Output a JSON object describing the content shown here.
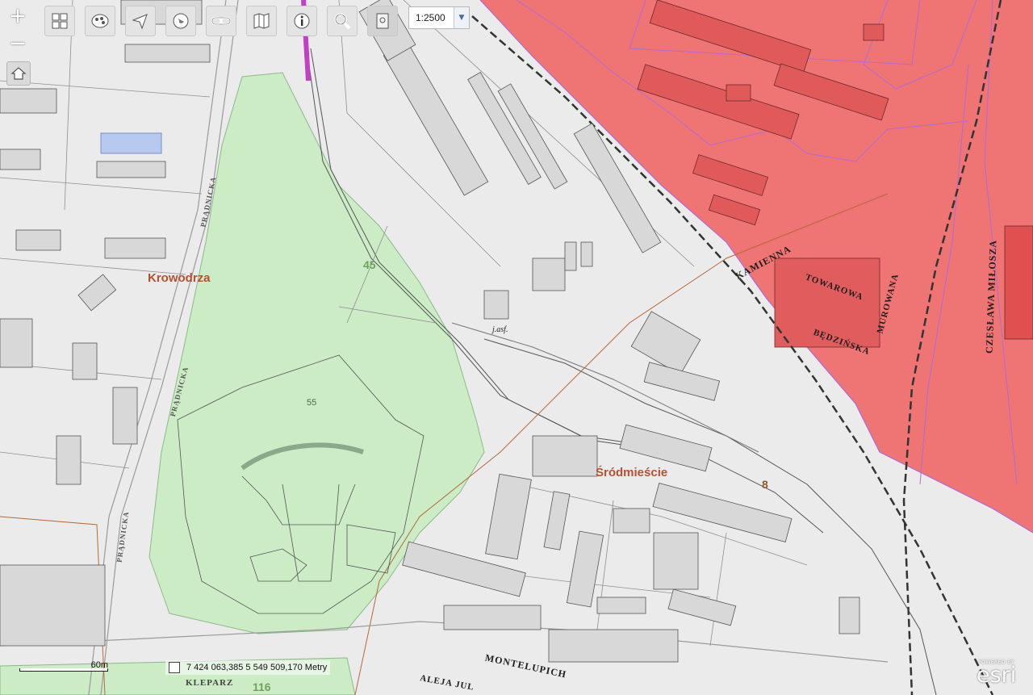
{
  "toolbar": {
    "zoom_in": "+",
    "zoom_out": "−",
    "tools": [
      {
        "icon": "grid-layers-icon"
      },
      {
        "icon": "palette-icon"
      },
      {
        "icon": "pan-arrows-icon"
      },
      {
        "icon": "globe-icon"
      },
      {
        "icon": "link-icon"
      },
      {
        "icon": "book-map-icon"
      },
      {
        "icon": "info-icon"
      },
      {
        "icon": "search-icon"
      },
      {
        "icon": "print-icon"
      }
    ],
    "scale_value": "1:2500",
    "home_icon": "home-icon"
  },
  "labels": {
    "district_west": "Krowodrza",
    "district_east": "Śródmieście",
    "green_area_55": "55",
    "green_area_45": "45",
    "zone_8": "8",
    "zone_116": "116",
    "kleparz": "KLEPARZ"
  },
  "streets": {
    "kamienna": "KAMIENNA",
    "towarowa": "TOWAROWA",
    "bedzinska": "BĘDZIŃSKA",
    "murowana": "MUROWANA",
    "czeslawa_milosza": "CZESŁAWA MIŁOSZA",
    "montelupich": "MONTELUPICH",
    "pradnicka_1": "PRĄDNICKA",
    "pradnicka_2": "PRĄDNICKA",
    "pradnicka_3": "PRĄDNICKA",
    "aleja": "ALEJA JUL",
    "j_asf": "j.asf."
  },
  "status": {
    "coordinates": "7 424 063,385  5 549 509,170 Metry",
    "scalebar_label": "60m"
  },
  "colors": {
    "protected_zone": "#ef6e6e",
    "green_area": "#c9ecc3",
    "building": "#d9d9d9",
    "parcel_line": "#8a8a8a",
    "parcel_highlight": "#a88bf2"
  },
  "branding": {
    "logo_text": "esri",
    "logo_caption": "POWERED BY"
  }
}
